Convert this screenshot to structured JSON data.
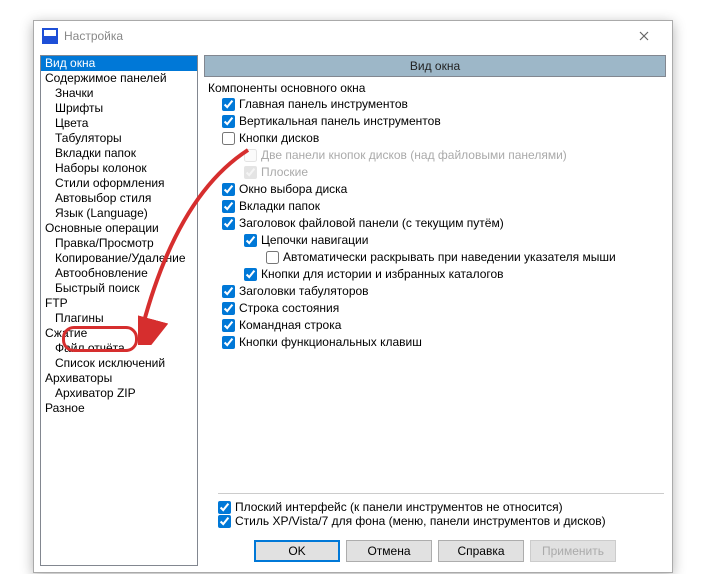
{
  "window": {
    "title": "Настройка"
  },
  "tree": {
    "items": [
      {
        "label": "Вид окна",
        "indent": 0,
        "selected": true
      },
      {
        "label": "Содержимое панелей",
        "indent": 0
      },
      {
        "label": "Значки",
        "indent": 1
      },
      {
        "label": "Шрифты",
        "indent": 1
      },
      {
        "label": "Цвета",
        "indent": 1
      },
      {
        "label": "Табуляторы",
        "indent": 1
      },
      {
        "label": "Вкладки папок",
        "indent": 1
      },
      {
        "label": "Наборы колонок",
        "indent": 1
      },
      {
        "label": "Стили оформления",
        "indent": 1
      },
      {
        "label": "Автовыбор стиля",
        "indent": 1
      },
      {
        "label": "Язык (Language)",
        "indent": 1
      },
      {
        "label": "Основные операции",
        "indent": 0
      },
      {
        "label": "Правка/Просмотр",
        "indent": 1
      },
      {
        "label": "Копирование/Удаление",
        "indent": 1
      },
      {
        "label": "Автообновление",
        "indent": 1
      },
      {
        "label": "Быстрый поиск",
        "indent": 1
      },
      {
        "label": "FTP",
        "indent": 0
      },
      {
        "label": "Плагины",
        "indent": 1
      },
      {
        "label": "Сжатие",
        "indent": 0
      },
      {
        "label": "Файл отчёта",
        "indent": 1
      },
      {
        "label": "Список исключений",
        "indent": 1
      },
      {
        "label": "Архиваторы",
        "indent": 0
      },
      {
        "label": "Архиватор ZIP",
        "indent": 1
      },
      {
        "label": "Разное",
        "indent": 0
      }
    ]
  },
  "sectionHeader": "Вид окна",
  "groupTitle": "Компоненты основного окна",
  "options": [
    {
      "label": "Главная панель инструментов",
      "checked": true,
      "level": 0,
      "disabled": false
    },
    {
      "label": "Вертикальная панель инструментов",
      "checked": true,
      "level": 0,
      "disabled": false
    },
    {
      "label": "Кнопки дисков",
      "checked": false,
      "level": 0,
      "disabled": false
    },
    {
      "label": "Две панели кнопок дисков (над файловыми панелями)",
      "checked": false,
      "level": 1,
      "disabled": true
    },
    {
      "label": "Плоские",
      "checked": true,
      "level": 1,
      "disabled": true
    },
    {
      "label": "Окно выбора диска",
      "checked": true,
      "level": 0,
      "disabled": false
    },
    {
      "label": "Вкладки папок",
      "checked": true,
      "level": 0,
      "disabled": false
    },
    {
      "label": "Заголовок файловой панели (с текущим путём)",
      "checked": true,
      "level": 0,
      "disabled": false
    },
    {
      "label": "Цепочки навигации",
      "checked": true,
      "level": 1,
      "disabled": false
    },
    {
      "label": "Автоматически раскрывать при наведении указателя мыши",
      "checked": false,
      "level": 2,
      "disabled": false
    },
    {
      "label": "Кнопки для истории и избранных каталогов",
      "checked": true,
      "level": 1,
      "disabled": false
    },
    {
      "label": "Заголовки табуляторов",
      "checked": true,
      "level": 0,
      "disabled": false
    },
    {
      "label": "Строка состояния",
      "checked": true,
      "level": 0,
      "disabled": false
    },
    {
      "label": "Командная строка",
      "checked": true,
      "level": 0,
      "disabled": false
    },
    {
      "label": "Кнопки функциональных клавиш",
      "checked": true,
      "level": 0,
      "disabled": false
    }
  ],
  "bottomOptions": [
    {
      "label": "Плоский интерфейс (к панели инструментов не относится)",
      "checked": true
    },
    {
      "label": "Стиль XP/Vista/7 для фона (меню, панели инструментов и дисков)",
      "checked": true
    }
  ],
  "buttons": {
    "ok": "OK",
    "cancel": "Отмена",
    "help": "Справка",
    "apply": "Применить"
  }
}
